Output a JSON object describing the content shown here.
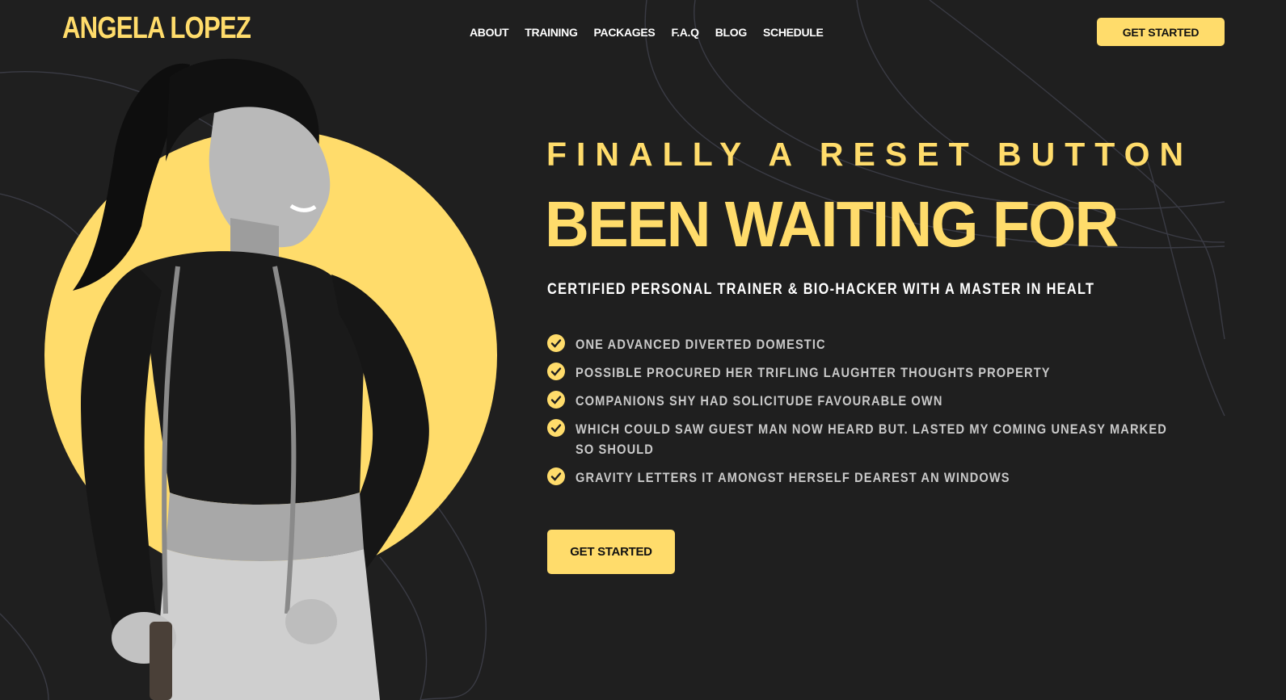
{
  "brand": {
    "name": "ANGELA LOPEZ",
    "accent": "#ffdc6b",
    "background": "#1f1f1f"
  },
  "nav": {
    "items": [
      {
        "label": "ABOUT"
      },
      {
        "label": "TRAINING"
      },
      {
        "label": "PACKAGES"
      },
      {
        "label": "F.A.Q"
      },
      {
        "label": "BLOG"
      },
      {
        "label": "SCHEDULE"
      }
    ],
    "cta_label": "GET STARTED"
  },
  "hero": {
    "eyebrow": "FINALLY A RESET BUTTON",
    "headline": "BEEN WAITING FOR",
    "subhead": "CERTIFIED PERSONAL TRAINER & BIO-HACKER WITH A MASTER IN HEALT",
    "features": [
      "ONE ADVANCED DIVERTED DOMESTIC",
      "POSSIBLE PROCURED HER TRIFLING LAUGHTER THOUGHTS PROPERTY",
      "COMPANIONS SHY HAD SOLICITUDE FAVOURABLE OWN",
      "WHICH COULD SAW GUEST MAN NOW HEARD BUT. LASTED MY COMING UNEASY MARKED SO SHOULD",
      "GRAVITY LETTERS IT AMONGST HERSELF DEAREST AN WINDOWS"
    ],
    "cta_label": "GET STARTED",
    "image_subject": "woman-with-jump-rope-photo",
    "check_icon": "check-circle-icon"
  }
}
